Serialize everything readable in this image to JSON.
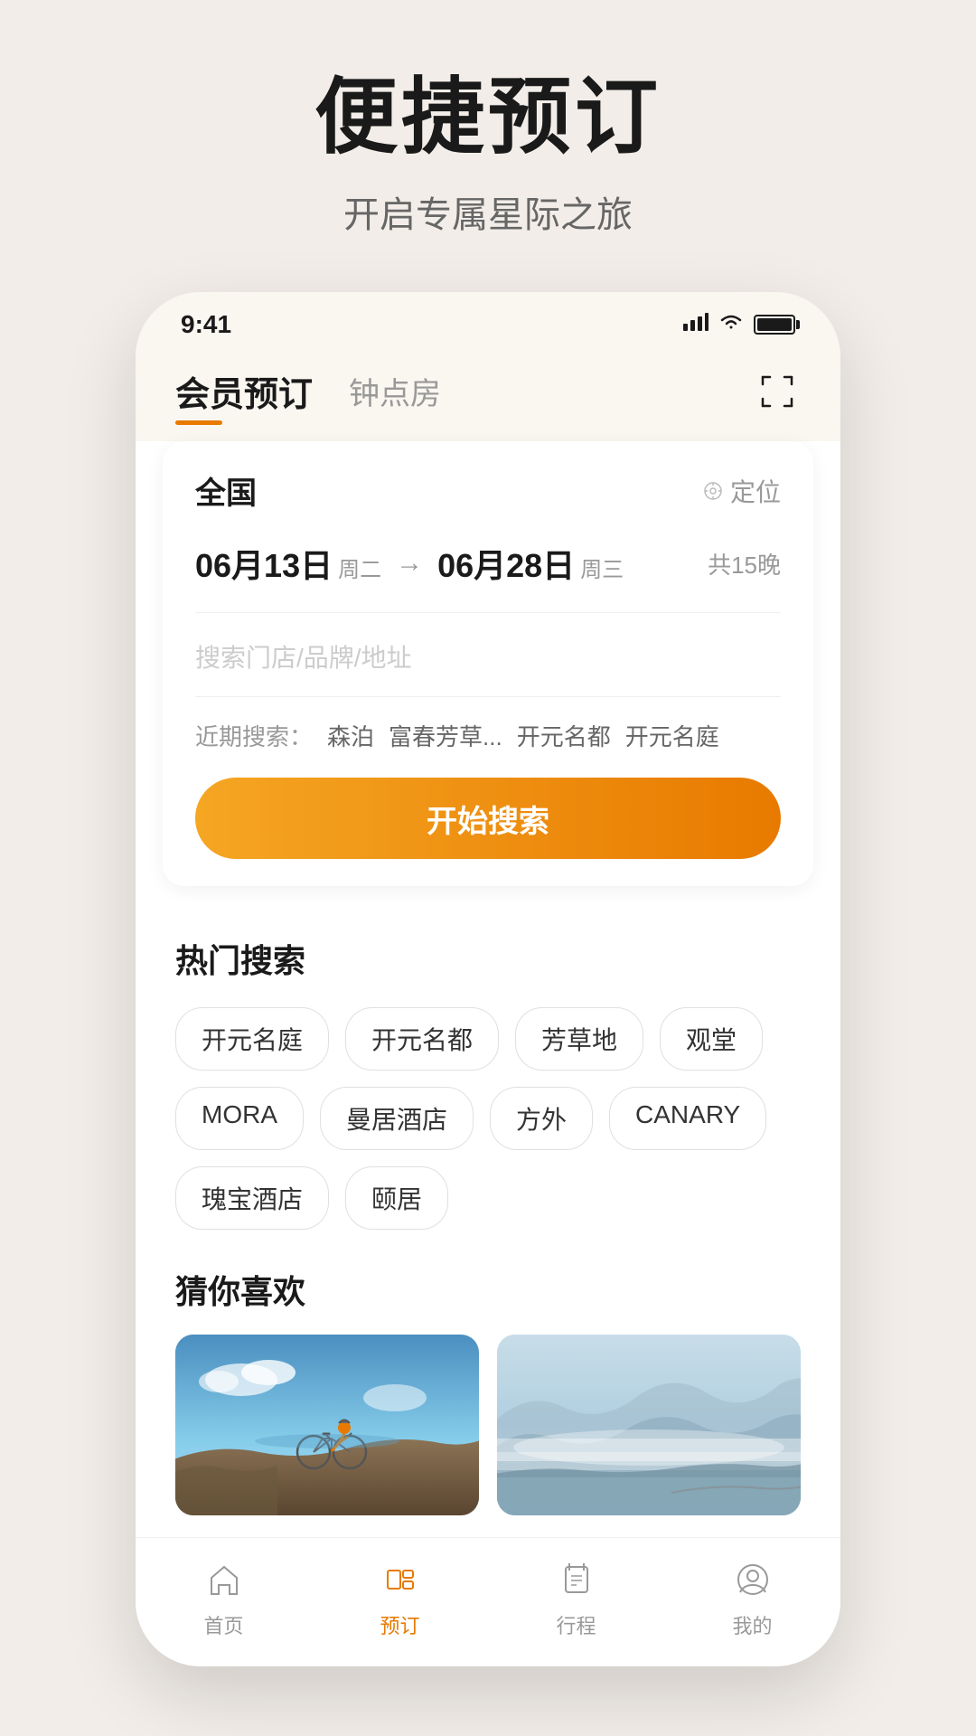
{
  "page": {
    "title": "便捷预订",
    "subtitle": "开启专属星际之旅"
  },
  "status_bar": {
    "time": "9:41"
  },
  "app_header": {
    "tab_active": "会员预订",
    "tab_inactive": "钟点房"
  },
  "search_card": {
    "location": "全国",
    "location_btn": "定位",
    "date_start": "06月13日",
    "date_start_day": "周二",
    "date_end": "06月28日",
    "date_end_day": "周三",
    "arrow": "—",
    "nights": "共15晚",
    "search_placeholder": "搜索门店/品牌/地址",
    "recent_label": "近期搜索：",
    "recent_tags": [
      "森泊",
      "富春芳草...",
      "开元名都",
      "开元名庭"
    ],
    "search_btn": "开始搜索"
  },
  "hot_search": {
    "title": "热门搜索",
    "tags": [
      "开元名庭",
      "开元名都",
      "芳草地",
      "观堂",
      "MORA",
      "曼居酒店",
      "方外",
      "CANARY",
      "瑰宝酒店",
      "颐居"
    ]
  },
  "recommendations": {
    "title": "猜你喜欢",
    "card1_alt": "cycling",
    "card2_alt": "mountain"
  },
  "bottom_nav": {
    "items": [
      {
        "label": "首页",
        "active": false,
        "icon": "home-icon"
      },
      {
        "label": "预订",
        "active": true,
        "icon": "booking-icon"
      },
      {
        "label": "行程",
        "active": false,
        "icon": "itinerary-icon"
      },
      {
        "label": "我的",
        "active": false,
        "icon": "profile-icon"
      }
    ]
  }
}
